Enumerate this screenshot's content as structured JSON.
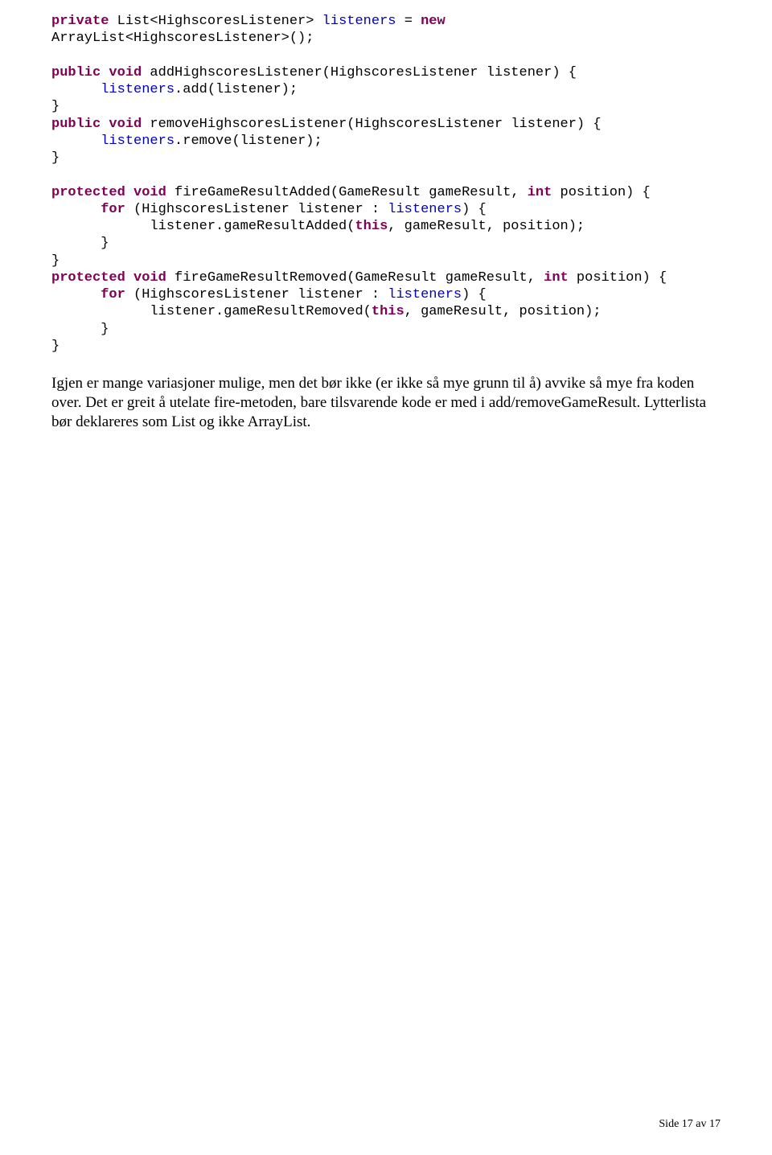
{
  "code": {
    "l01_a": "private",
    "l01_b": " List<HighscoresListener> ",
    "l01_c": "listeners",
    "l01_d": " = ",
    "l01_e": "new",
    "l02_a": "ArrayList<HighscoresListener>();",
    "l04_a": "public",
    "l04_b": " ",
    "l04_c": "void",
    "l04_d": " addHighscoresListener(HighscoresListener listener) {",
    "l05_a": "      ",
    "l05_b": "listeners",
    "l05_c": ".add(listener);",
    "l06_a": "}",
    "l07_a": "public",
    "l07_b": " ",
    "l07_c": "void",
    "l07_d": " removeHighscoresListener(HighscoresListener listener) {",
    "l08_a": "      ",
    "l08_b": "listeners",
    "l08_c": ".remove(listener);",
    "l09_a": "}",
    "l11_a": "protected",
    "l11_b": " ",
    "l11_c": "void",
    "l11_d": " fireGameResultAdded(GameResult gameResult, ",
    "l11_e": "int",
    "l11_f": " position) {",
    "l12_a": "      ",
    "l12_b": "for",
    "l12_c": " (HighscoresListener listener : ",
    "l12_d": "listeners",
    "l12_e": ") {",
    "l13_a": "            listener.gameResultAdded(",
    "l13_b": "this",
    "l13_c": ", gameResult, position);",
    "l14_a": "      }",
    "l15_a": "}",
    "l16_a": "protected",
    "l16_b": " ",
    "l16_c": "void",
    "l16_d": " fireGameResultRemoved(GameResult gameResult, ",
    "l16_e": "int",
    "l16_f": " position) {",
    "l17_a": "      ",
    "l17_b": "for",
    "l17_c": " (HighscoresListener listener : ",
    "l17_d": "listeners",
    "l17_e": ") {",
    "l18_a": "            listener.gameResultRemoved(",
    "l18_b": "this",
    "l18_c": ", gameResult, position);",
    "l19_a": "      }",
    "l20_a": "}"
  },
  "prose": "Igjen er mange variasjoner mulige, men det bør ikke (er ikke så mye grunn til å) avvike så mye fra koden over. Det er greit å utelate fire-metoden, bare tilsvarende kode er med i add/removeGameResult. Lytterlista bør deklareres som List og ikke ArrayList.",
  "footer": "Side 17 av 17"
}
